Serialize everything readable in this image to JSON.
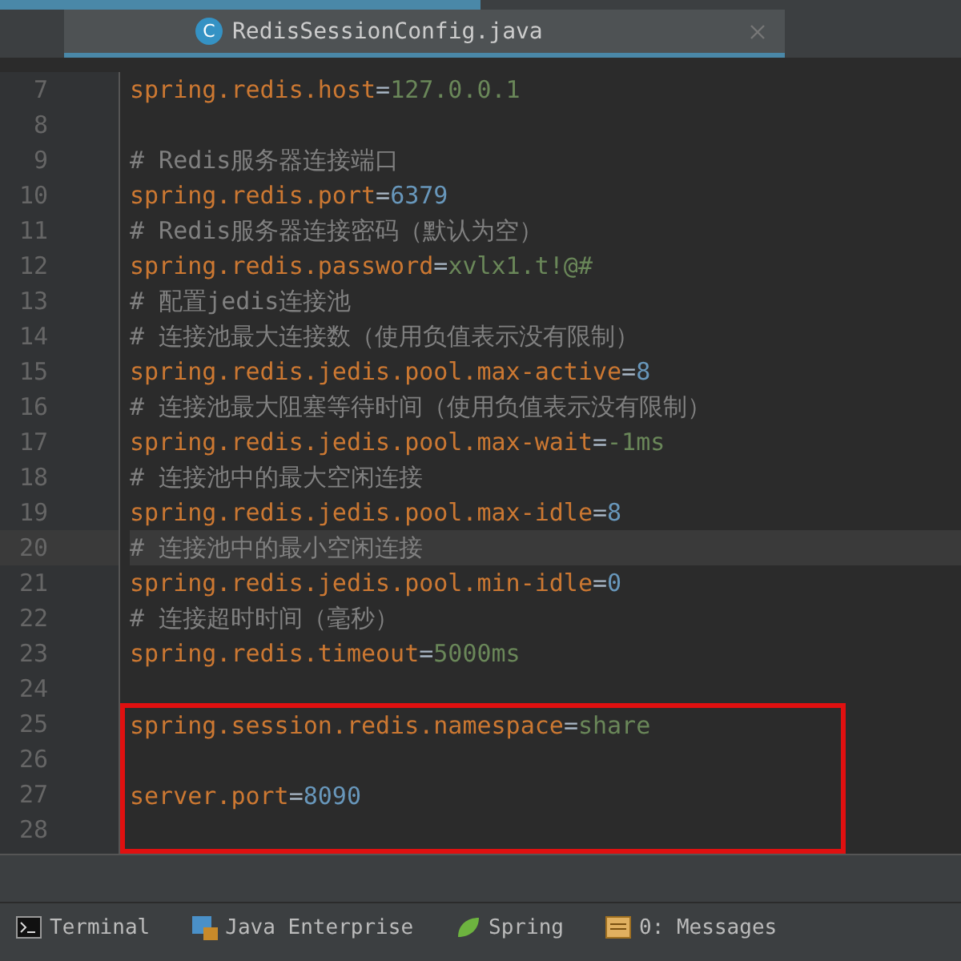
{
  "tab": {
    "title": "RedisSessionConfig.java",
    "icon": "C",
    "selected": true
  },
  "editor": {
    "lines": [
      {
        "number": "7",
        "kind": "property",
        "key": "spring.redis.host",
        "separator": "=",
        "value": {
          "kind": "string",
          "text": "127.0.0.1"
        },
        "current": false,
        "boxed": false
      },
      {
        "number": "8",
        "kind": "blank",
        "current": false,
        "boxed": false
      },
      {
        "number": "9",
        "kind": "comment",
        "text": "# Redis服务器连接端口",
        "current": false,
        "boxed": false
      },
      {
        "number": "10",
        "kind": "property",
        "key": "spring.redis.port",
        "separator": "=",
        "value": {
          "kind": "number",
          "text": "6379"
        },
        "current": false,
        "boxed": false
      },
      {
        "number": "11",
        "kind": "comment",
        "text": "# Redis服务器连接密码（默认为空）",
        "current": false,
        "boxed": false
      },
      {
        "number": "12",
        "kind": "property",
        "key": "spring.redis.password",
        "separator": "=",
        "value": {
          "kind": "string",
          "text": "xvlx1.t!@#"
        },
        "current": false,
        "boxed": false
      },
      {
        "number": "13",
        "kind": "comment",
        "text": "# 配置jedis连接池",
        "current": false,
        "boxed": false
      },
      {
        "number": "14",
        "kind": "comment",
        "text": "# 连接池最大连接数（使用负值表示没有限制）",
        "current": false,
        "boxed": false
      },
      {
        "number": "15",
        "kind": "property",
        "key": "spring.redis.jedis.pool.max-active",
        "separator": "=",
        "value": {
          "kind": "number",
          "text": "8"
        },
        "current": false,
        "boxed": false
      },
      {
        "number": "16",
        "kind": "comment",
        "text": "# 连接池最大阻塞等待时间（使用负值表示没有限制）",
        "current": false,
        "boxed": false
      },
      {
        "number": "17",
        "kind": "property",
        "key": "spring.redis.jedis.pool.max-wait",
        "separator": "=",
        "value": {
          "kind": "string",
          "text": "-1ms"
        },
        "current": false,
        "boxed": false
      },
      {
        "number": "18",
        "kind": "comment",
        "text": "# 连接池中的最大空闲连接",
        "current": false,
        "boxed": false
      },
      {
        "number": "19",
        "kind": "property",
        "key": "spring.redis.jedis.pool.max-idle",
        "separator": "=",
        "value": {
          "kind": "number",
          "text": "8"
        },
        "current": false,
        "boxed": false
      },
      {
        "number": "20",
        "kind": "comment",
        "text": "# 连接池中的最小空闲连接",
        "current": true,
        "boxed": false
      },
      {
        "number": "21",
        "kind": "property",
        "key": "spring.redis.jedis.pool.min-idle",
        "separator": "=",
        "value": {
          "kind": "number",
          "text": "0"
        },
        "current": false,
        "boxed": false
      },
      {
        "number": "22",
        "kind": "comment",
        "text": "# 连接超时时间（毫秒）",
        "current": false,
        "boxed": false
      },
      {
        "number": "23",
        "kind": "property",
        "key": "spring.redis.timeout",
        "separator": "=",
        "value": {
          "kind": "string",
          "text": "5000ms"
        },
        "current": false,
        "boxed": false
      },
      {
        "number": "24",
        "kind": "blank",
        "current": false,
        "boxed": false
      },
      {
        "number": "25",
        "kind": "property",
        "key": "spring.session.redis.namespace",
        "separator": "=",
        "value": {
          "kind": "string",
          "text": "share"
        },
        "current": false,
        "boxed": true
      },
      {
        "number": "26",
        "kind": "blank",
        "current": false,
        "boxed": true
      },
      {
        "number": "27",
        "kind": "property",
        "key": "server.port",
        "separator": "=",
        "value": {
          "kind": "number",
          "text": "8090"
        },
        "current": false,
        "boxed": true
      },
      {
        "number": "28",
        "kind": "blank",
        "current": false,
        "boxed": true
      }
    ]
  },
  "tool_windows": [
    {
      "label": "Terminal",
      "kind": "terminal"
    },
    {
      "label": "Java Enterprise",
      "kind": "enterprise"
    },
    {
      "label": "Spring",
      "kind": "spring"
    },
    {
      "label": "0: Messages",
      "kind": "messages"
    }
  ]
}
